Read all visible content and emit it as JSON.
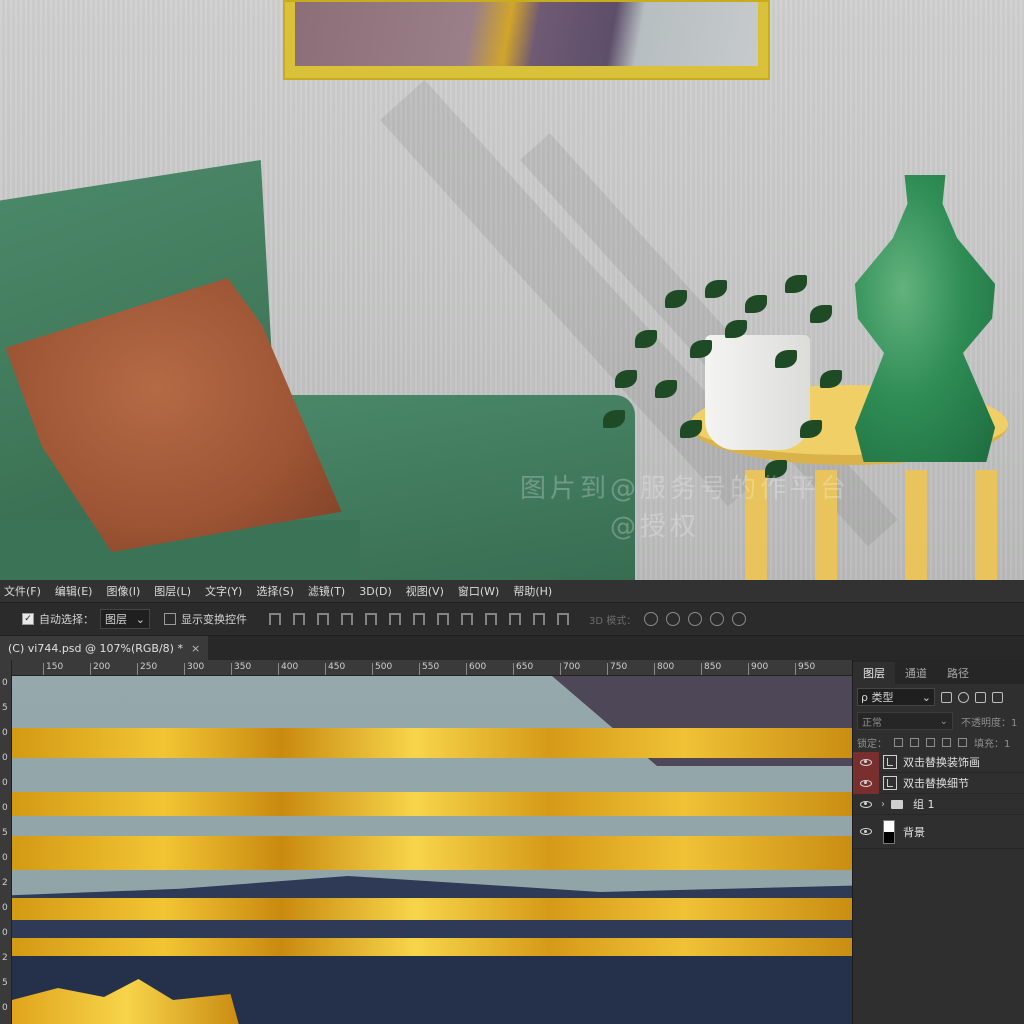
{
  "menubar": {
    "items": [
      "文件(F)",
      "编辑(E)",
      "图像(I)",
      "图层(L)",
      "文字(Y)",
      "选择(S)",
      "滤镜(T)",
      "3D(D)",
      "视图(V)",
      "窗口(W)",
      "帮助(H)"
    ]
  },
  "options": {
    "auto_select_label": "自动选择：",
    "auto_select_value": "图层",
    "show_transform_label": "显示变换控件",
    "mode_3d_label": "3D 模式："
  },
  "document": {
    "tab_title": "(C) vi744.psd @ 107%(RGB/8) *",
    "close_glyph": "×"
  },
  "ruler": {
    "h_labels": [
      "150",
      "200",
      "250",
      "300",
      "350",
      "400",
      "450",
      "500",
      "550",
      "600",
      "650",
      "700",
      "750",
      "800",
      "850",
      "900",
      "950"
    ],
    "v_labels": [
      "0",
      "5",
      "0",
      "0",
      "0",
      "0",
      "5",
      "0",
      "2",
      "0",
      "0",
      "2",
      "5",
      "0"
    ]
  },
  "layers_panel": {
    "tabs": [
      "图层",
      "通道",
      "路径"
    ],
    "filter_label": "ρ 类型",
    "blend_mode": "正常",
    "opacity_label": "不透明度：1",
    "lock_label": "锁定：",
    "fill_label": "填充：1",
    "layers": [
      {
        "name": "双击替换装饰画",
        "type": "smart"
      },
      {
        "name": "双击替换细节",
        "type": "smart"
      },
      {
        "name": "组 1",
        "type": "group"
      },
      {
        "name": "背景",
        "type": "background"
      }
    ]
  },
  "watermark": {
    "line1": "图片到@服务号的作平台",
    "line2": "@授权"
  },
  "colors": {
    "menubar_bg": "#323232",
    "panel_bg": "#2f2f2f",
    "gold_accent": "#f2c534",
    "smart_eye_highlight": "#7a2f2f"
  }
}
